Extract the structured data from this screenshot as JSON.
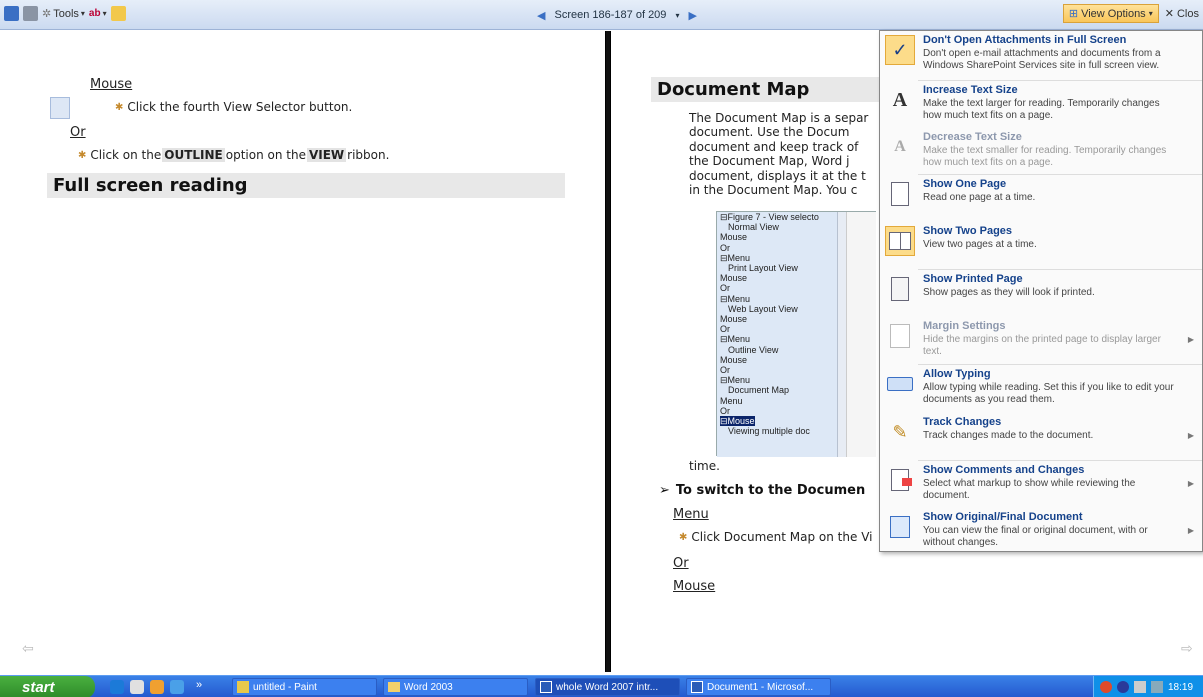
{
  "toolbar": {
    "tools_label": "Tools",
    "screen_label": "Screen 186-187 of 209",
    "view_options_label": "View Options",
    "close_label": "Clos"
  },
  "left_page": {
    "link_mouse": "Mouse",
    "bullet1": "Click the fourth View Selector button.",
    "link_or": "Or",
    "bullet2_pre": "Click on the ",
    "bullet2_b1": "OUTLINE",
    "bullet2_mid": " option on the ",
    "bullet2_b2": "VIEW",
    "bullet2_post": " ribbon.",
    "heading": "Full screen reading"
  },
  "right_page": {
    "heading": "Document Map",
    "para_lines": [
      "The Document Map is a separ",
      "document. Use the Docum",
      "document and keep track of",
      "the Document Map, Word j",
      "document, displays it at the t",
      "in the Document Map. You c"
    ],
    "mini_items": [
      "⊟Figure 7 - View selecto",
      "  Normal View",
      "Mouse",
      "Or",
      "⊟Menu",
      "  Print Layout View",
      "Mouse",
      "Or",
      "⊟Menu",
      "  Web Layout View",
      "Mouse",
      "Or",
      "⊟Menu",
      "  Outline View",
      "Mouse",
      "Or",
      "⊟Menu",
      "  Document Map",
      "Menu",
      "Or",
      "⊟Mouse",
      "  Viewing multiple doc"
    ],
    "time": "time.",
    "switch_heading": "To switch to the Documen",
    "link_menu": "Menu",
    "bullet_click": "Click Document Map on the Vi",
    "link_or": "Or",
    "link_mouse": "Mouse"
  },
  "dropdown": {
    "items": [
      {
        "title": "Don't Open Attachments in Full Screen",
        "desc": "Don't open e-mail attachments and documents from a Windows SharePoint Services site in full screen view."
      },
      {
        "title": "Increase Text Size",
        "desc": "Make the text larger for reading. Temporarily changes how much text fits on a page."
      },
      {
        "title": "Decrease Text Size",
        "desc": "Make the text smaller for reading. Temporarily changes how much text fits on a page."
      },
      {
        "title": "Show One Page",
        "desc": "Read one page at a time."
      },
      {
        "title": "Show Two Pages",
        "desc": "View two pages at a time."
      },
      {
        "title": "Show Printed Page",
        "desc": "Show pages as they will look if printed."
      },
      {
        "title": "Margin Settings",
        "desc": "Hide the margins on the printed page to display larger text."
      },
      {
        "title": "Allow Typing",
        "desc": "Allow typing while reading. Set this if you like to edit your documents as you read them."
      },
      {
        "title": "Track Changes",
        "desc": "Track changes made to the document."
      },
      {
        "title": "Show Comments and Changes",
        "desc": "Select what markup to show while reviewing the document."
      },
      {
        "title": "Show Original/Final Document",
        "desc": "You can view the final or original document, with or without changes."
      }
    ]
  },
  "taskbar": {
    "start": "start",
    "tasks": [
      "untitled - Paint",
      "Word 2003",
      "whole Word 2007 intr...",
      "Document1 - Microsof..."
    ],
    "clock": "18:19"
  }
}
